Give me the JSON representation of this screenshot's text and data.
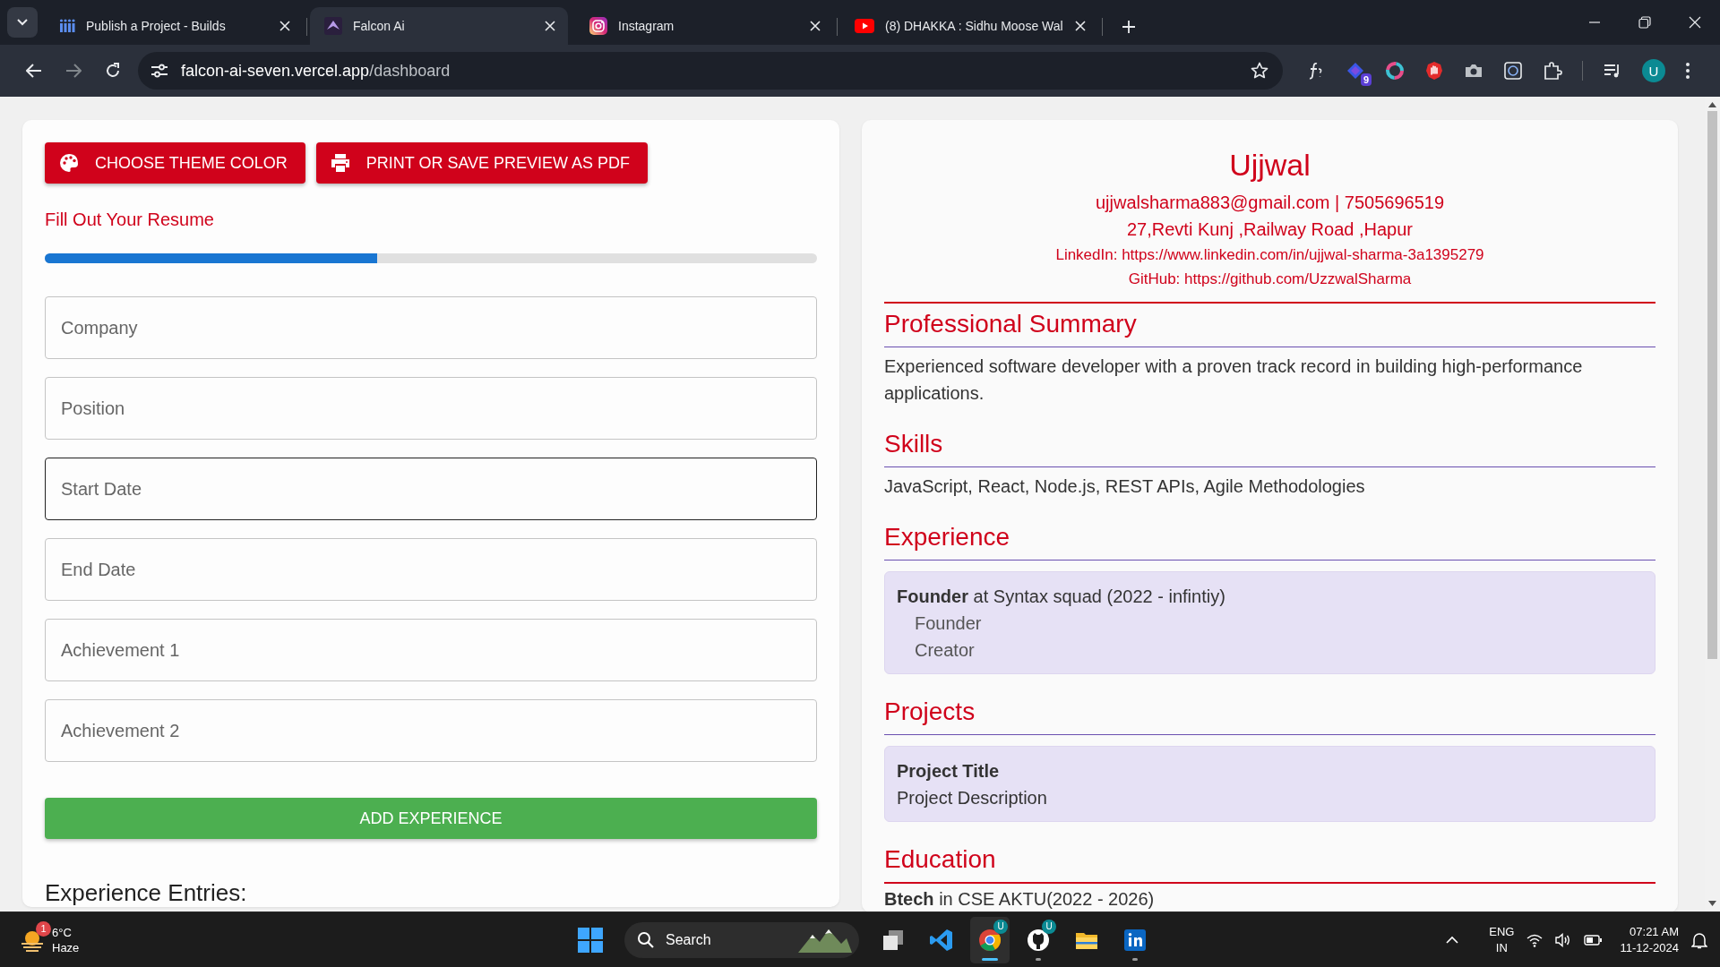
{
  "browser": {
    "tabs": [
      {
        "title": "Publish a Project - Builds",
        "kind": "builds",
        "selected": false
      },
      {
        "title": "Falcon Ai",
        "kind": "falcon",
        "selected": true
      },
      {
        "title": "Instagram",
        "kind": "instagram",
        "selected": false
      },
      {
        "title": "(8) DHAKKA : Sidhu Moose Wal",
        "kind": "youtube",
        "selected": false
      }
    ],
    "address": {
      "host": "falcon-ai-seven.vercel.app",
      "path": "/dashboard"
    },
    "extension_badge": "9",
    "profile_initial": "U"
  },
  "form": {
    "buttons": [
      {
        "label": "CHOOSE THEME COLOR",
        "kind": "palette"
      },
      {
        "label": "PRINT OR SAVE PREVIEW AS PDF",
        "kind": "print"
      }
    ],
    "heading": "Fill Out Your Resume",
    "progress": {
      "level": 0.43
    },
    "fields": [
      {
        "placeholder": "Company",
        "focused": false
      },
      {
        "placeholder": "Position",
        "focused": false
      },
      {
        "placeholder": "Start Date",
        "focused": true
      },
      {
        "placeholder": "End Date",
        "focused": false
      },
      {
        "placeholder": "Achievement 1",
        "focused": false
      },
      {
        "placeholder": "Achievement 2",
        "focused": false
      }
    ],
    "add_button": "ADD EXPERIENCE",
    "entries_heading": "Experience Entries:"
  },
  "resume": {
    "name": "Ujjwal",
    "contact": [
      "ujjwalsharma883@gmail.com | 7505696519",
      "27,Revti Kunj ,Railway Road ,Hapur"
    ],
    "links": [
      "LinkedIn: https://www.linkedin.com/in/ujjwal-sharma-3a1395279",
      "GitHub: https://github.com/UzzwalSharma"
    ],
    "sections": [
      {
        "kind": "text",
        "title": "Professional Summary",
        "text": "Experienced software developer with a proven track record in building high-performance applications."
      },
      {
        "kind": "text",
        "title": "Skills",
        "text": "JavaScript, React, Node.js, REST APIs, Agile Methodologies"
      },
      {
        "kind": "experience",
        "title": "Experience",
        "entries": [
          {
            "headline": "**Founder** at Syntax squad (2022 - infintiy)",
            "points": [
              "Founder",
              "Creator"
            ]
          }
        ]
      },
      {
        "kind": "projects",
        "title": "Projects",
        "entries": [
          {
            "title": "Project Title",
            "description": "Project Description"
          }
        ]
      },
      {
        "kind": "education",
        "title": "Education",
        "entries": [
          {
            "line": "**Btech** in CSE AKTU(2022 - 2026)"
          }
        ]
      }
    ]
  },
  "taskbar": {
    "weather": {
      "temperature": "6°C",
      "condition": "Haze",
      "badge": "1"
    },
    "search": {
      "placeholder": "Search"
    },
    "apps": [
      {
        "kind": "taskview",
        "running": false,
        "focused": false
      },
      {
        "kind": "vscode",
        "running": false,
        "focused": false
      },
      {
        "kind": "chrome",
        "badge": "U",
        "running": true,
        "focused": true
      },
      {
        "kind": "github",
        "badge": "U",
        "running": true,
        "focused": false
      },
      {
        "kind": "explorer",
        "running": false,
        "focused": false
      },
      {
        "kind": "linkedin",
        "running": true,
        "focused": false
      }
    ],
    "language": "ENG",
    "region": "IN",
    "time": "07:21 AM",
    "date": "11-12-2024"
  }
}
